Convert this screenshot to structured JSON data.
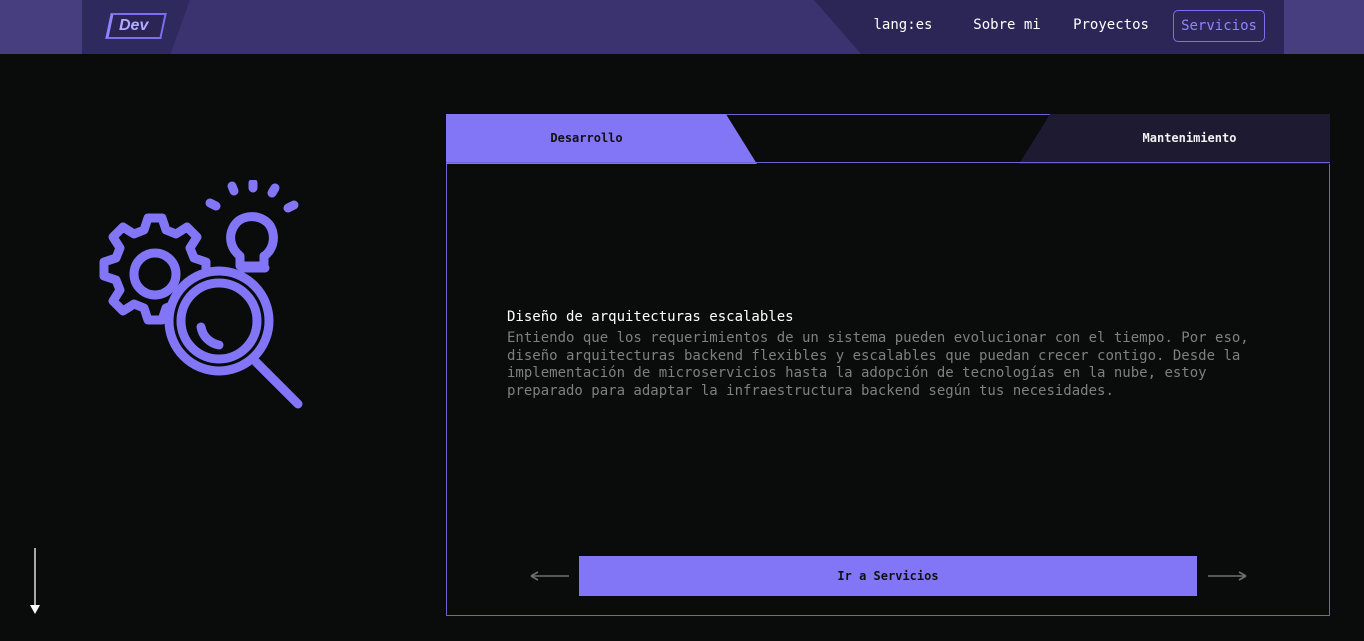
{
  "header": {
    "logo_text": "Dev",
    "nav": {
      "lang": "lang:es",
      "about": "Sobre mi",
      "projects": "Proyectos",
      "services": "Servicios"
    }
  },
  "panel": {
    "tabs": [
      "Desarrollo",
      "Mantenimiento"
    ],
    "active_tab": "Desarrollo",
    "title": "Diseño de arquitecturas escalables",
    "text": "Entiendo que los requerimientos de un sistema pueden evolucionar con el tiempo. Por eso, diseño arquitecturas backend flexibles y escalables que puedan crecer contigo. Desde la implementación de microservicios hasta la adopción de tecnologías en la nube, estoy preparado para adaptar la infraestructura backend según tus necesidades.",
    "cta": "Ir a Servicios"
  },
  "icons": {
    "illustration": "gear-magnifier-lightbulb-icon",
    "prev": "arrow-left-icon",
    "next": "arrow-right-icon",
    "scroll": "arrow-down-icon"
  },
  "colors": {
    "accent": "#8276f7",
    "background": "#0a0b0b",
    "header": "#3b3370"
  }
}
